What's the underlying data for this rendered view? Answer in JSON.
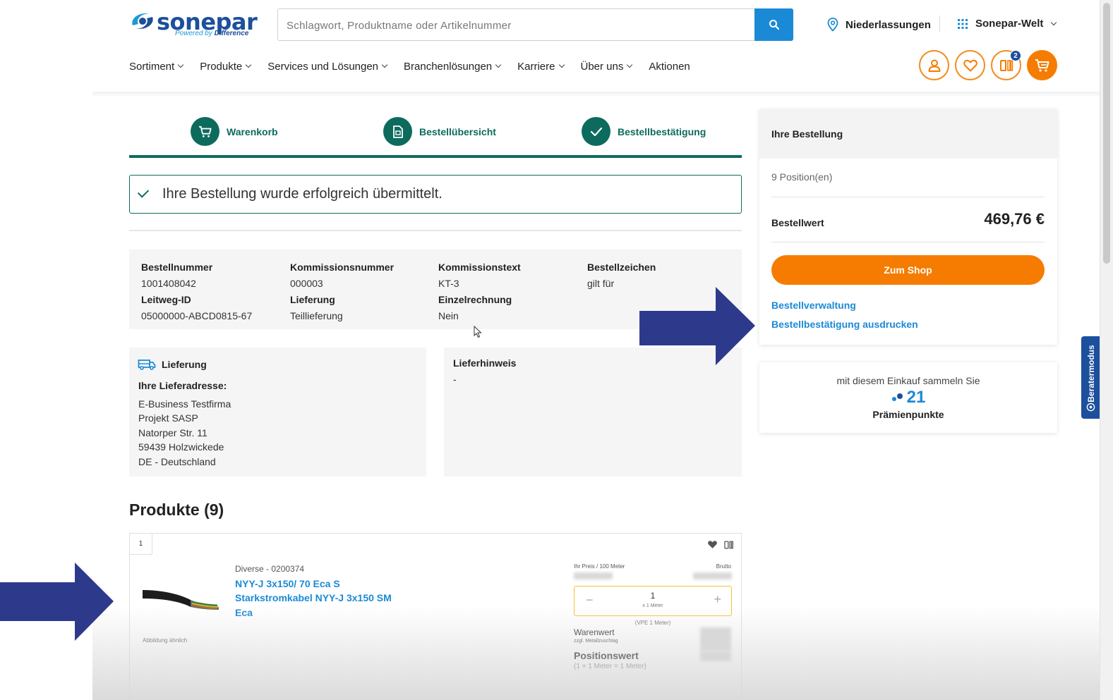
{
  "header": {
    "logo_word": "sonepar",
    "logo_tagline_prefix": "Powered by",
    "logo_tagline_brand": "Difference",
    "search_placeholder": "Schlagwort, Produktname oder Artikelnummer",
    "branches_label": "Niederlassungen",
    "world_label": "Sonepar-Welt",
    "compare_badge": "2"
  },
  "nav": {
    "items": [
      {
        "label": "Sortiment",
        "dropdown": true
      },
      {
        "label": "Produkte",
        "dropdown": true
      },
      {
        "label": "Services und Lösungen",
        "dropdown": true
      },
      {
        "label": "Branchenlösungen",
        "dropdown": true
      },
      {
        "label": "Karriere",
        "dropdown": true
      },
      {
        "label": "Über uns",
        "dropdown": true
      },
      {
        "label": "Aktionen",
        "dropdown": false
      }
    ]
  },
  "steps": [
    {
      "label": "Warenkorb",
      "icon": "cart-icon"
    },
    {
      "label": "Bestellübersicht",
      "icon": "document-icon"
    },
    {
      "label": "Bestellbestätigung",
      "icon": "check-icon"
    }
  ],
  "success_message": "Ihre Bestellung wurde erfolgreich übermittelt.",
  "order_info": {
    "bestellnummer_label": "Bestellnummer",
    "bestellnummer": "1001408042",
    "leitweg_label": "Leitweg-ID",
    "leitweg": "05000000-ABCD0815-67",
    "kommissionsnummer_label": "Kommissionsnummer",
    "kommissionsnummer": "000003",
    "lieferung_label": "Lieferung",
    "lieferung": "Teillieferung",
    "kommissionstext_label": "Kommissionstext",
    "kommissionstext": "KT-3",
    "einzelrechnung_label": "Einzelrechnung",
    "einzelrechnung": "Nein",
    "bestellzeichen_label": "Bestellzeichen",
    "bestellzeichen": "gilt für"
  },
  "delivery": {
    "title": "Lieferung",
    "address_label": "Ihre Lieferadresse:",
    "lines": [
      "E-Business Testfirma",
      "Projekt SASP",
      "Natorper Str. 11",
      "59439 Holzwickede",
      "DE - Deutschland"
    ]
  },
  "hint": {
    "title": "Lieferhinweis",
    "value": "-"
  },
  "products": {
    "title": "Produkte (9)",
    "item": {
      "position": "1",
      "meta": "Diverse - 0200374",
      "name": "NYY-J 3x150/ 70 Eca S Starkstromkabel NYY-J 3x150 SM Eca",
      "image_note": "Abbildung ähnlich",
      "price_label": "Ihr Preis / 100 Meter",
      "brutto_label": "Brutto",
      "qty_value": "1",
      "qty_unit": "x 1 Meter",
      "qty_minus": "−",
      "qty_plus": "+",
      "vpe": "(VPE 1 Meter)",
      "warenwert_label": "Warenwert",
      "warenwert_sub": "zzgl. Metallzuschlag",
      "positionswert_label": "Positionswert",
      "positionswert_sub": "(1 × 1 Meter = 1 Meter)"
    }
  },
  "summary": {
    "title": "Ihre Bestellung",
    "positions": "9 Position(en)",
    "bestellwert_label": "Bestellwert",
    "bestellwert": "469,76 €",
    "shop_button": "Zum Shop",
    "link_verwaltung": "Bestellverwaltung",
    "link_print": "Bestellbestätigung ausdrucken"
  },
  "points": {
    "line1": "mit diesem Einkauf sammeln Sie",
    "value": "21",
    "line3": "Prämienpunkte"
  },
  "berater_tab": "Beratermodus",
  "colors": {
    "brand_blue": "#1c4f9c",
    "link_blue": "#1b8ad6",
    "accent_orange": "#f57c00",
    "success_green": "#0d6b5e",
    "annotation_arrow": "#2d3a8c"
  }
}
